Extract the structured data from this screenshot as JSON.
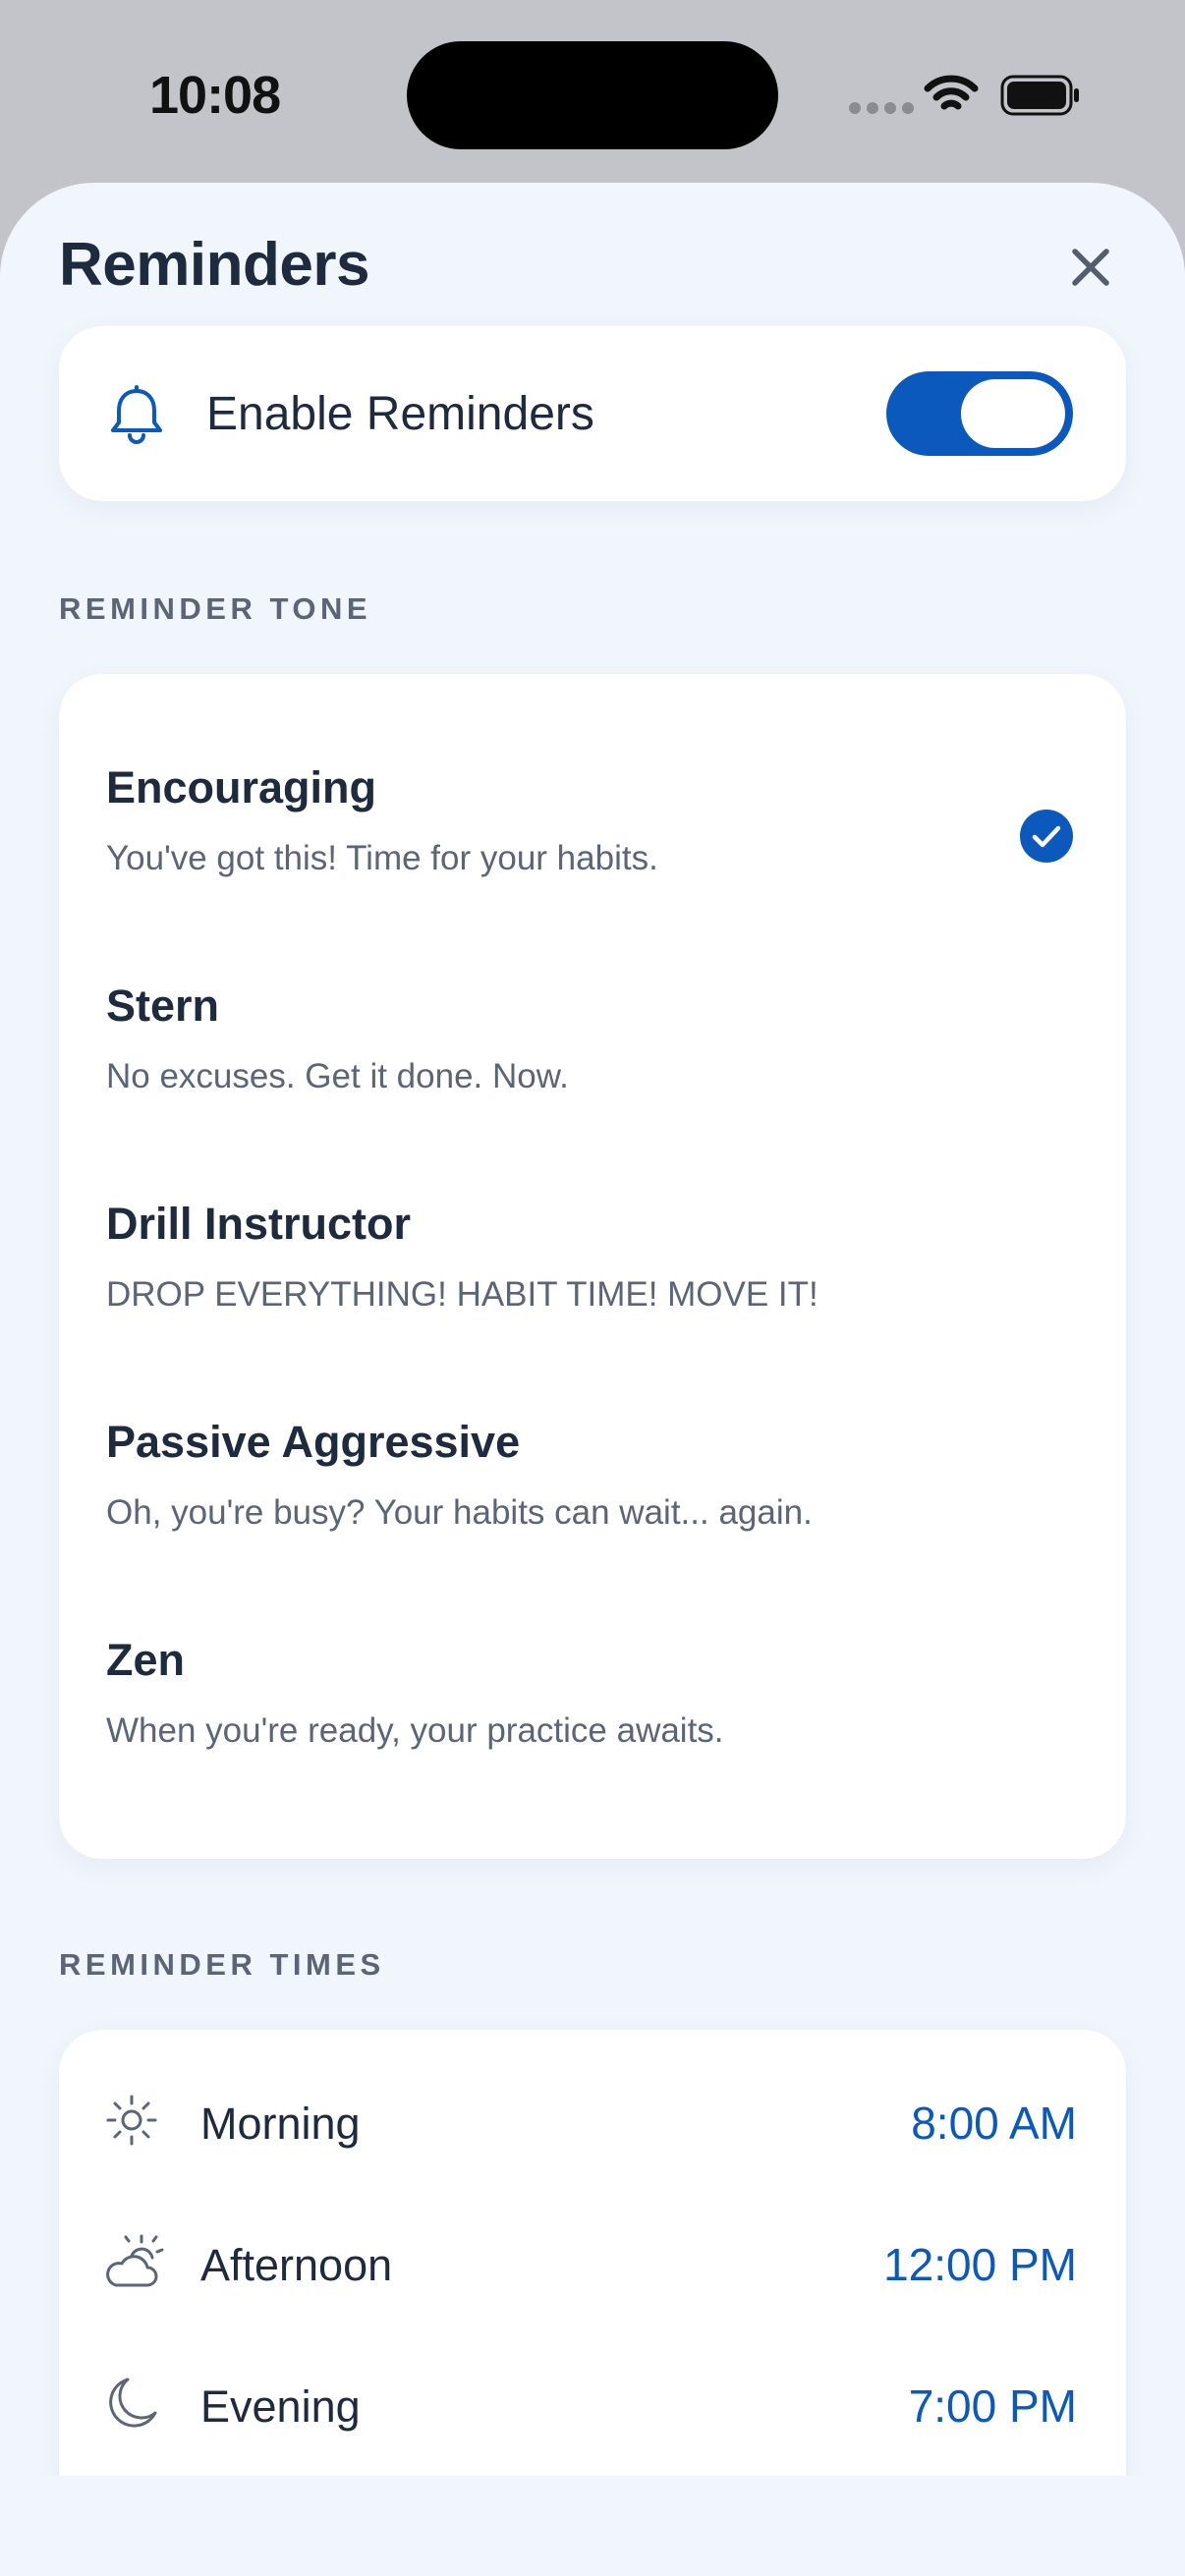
{
  "status_bar": {
    "time": "10:08"
  },
  "sheet": {
    "title": "Reminders"
  },
  "enable": {
    "label": "Enable Reminders",
    "enabled": true
  },
  "tone_section": {
    "label": "REMINDER TONE",
    "selected": "Encouraging",
    "options": [
      {
        "name": "Encouraging",
        "description": "You've got this! Time for your habits."
      },
      {
        "name": "Stern",
        "description": "No excuses. Get it done. Now."
      },
      {
        "name": "Drill Instructor",
        "description": "DROP EVERYTHING! HABIT TIME! MOVE IT!"
      },
      {
        "name": "Passive Aggressive",
        "description": "Oh, you're busy? Your habits can wait... again."
      },
      {
        "name": "Zen",
        "description": "When you're ready, your practice awaits."
      }
    ]
  },
  "times_section": {
    "label": "REMINDER TIMES",
    "rows": [
      {
        "label": "Morning",
        "time": "8:00 AM",
        "icon": "sun-icon"
      },
      {
        "label": "Afternoon",
        "time": "12:00 PM",
        "icon": "partly-cloudy-icon"
      },
      {
        "label": "Evening",
        "time": "7:00 PM",
        "icon": "moon-icon"
      }
    ]
  },
  "colors": {
    "accent": "#0b59bd",
    "sheet_background": "#f1f5fc",
    "card_background": "#ffffff",
    "text_primary": "#1e2a3d",
    "text_secondary": "#5b6577"
  }
}
